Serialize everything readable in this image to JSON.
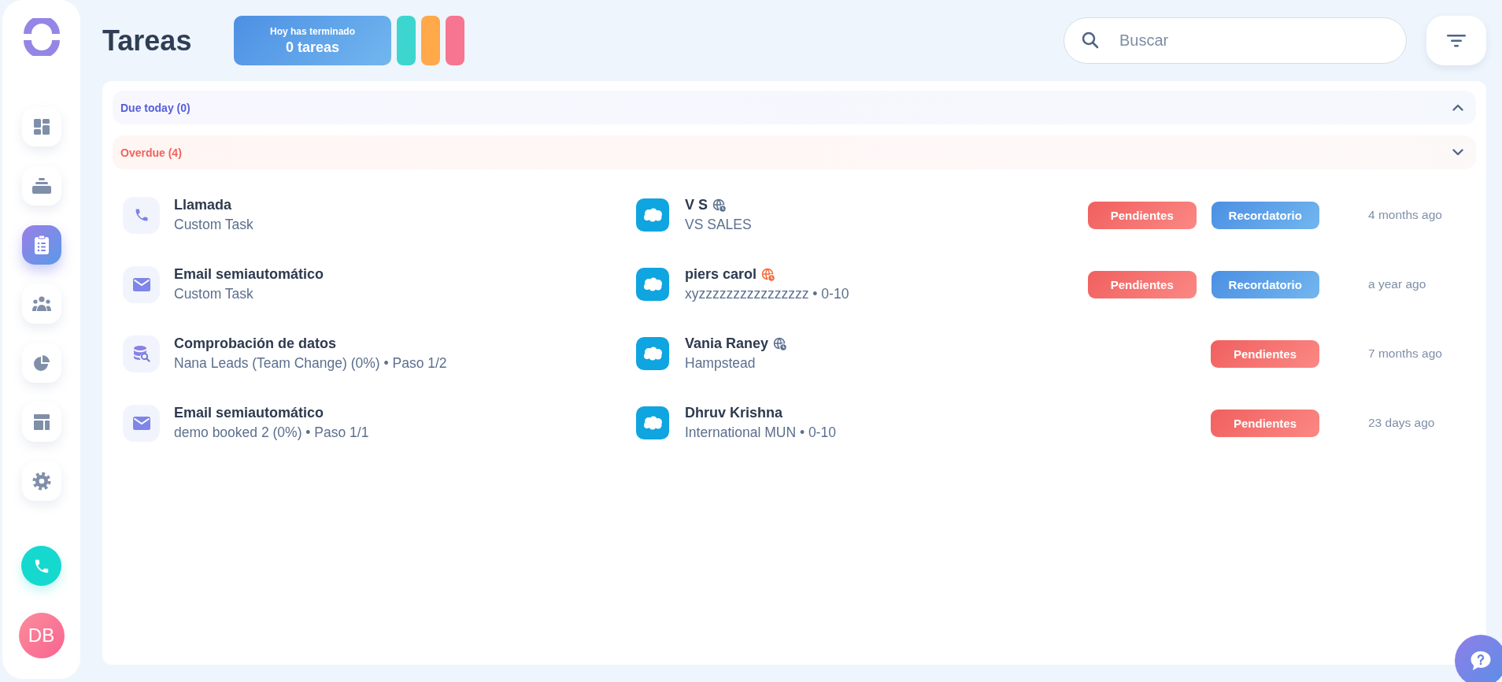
{
  "sidebar": {
    "nav": [
      {
        "kind": "dashboard",
        "selected": false
      },
      {
        "kind": "stack",
        "selected": false
      },
      {
        "kind": "clipboard",
        "selected": true
      },
      {
        "kind": "people",
        "selected": false
      },
      {
        "kind": "pie",
        "selected": false
      },
      {
        "kind": "layout",
        "selected": false
      },
      {
        "kind": "gear",
        "selected": false
      }
    ],
    "avatar": {
      "initials": "DB"
    }
  },
  "header": {
    "title": "Tareas",
    "summary": {
      "caption": "Hoy has terminado",
      "count": "0 tareas"
    },
    "pills": [
      {
        "color": "#3dd6cf"
      },
      {
        "color": "#ffa94a"
      },
      {
        "color": "#f77590"
      }
    ],
    "search": {
      "placeholder": "Buscar"
    }
  },
  "sections": [
    {
      "label": "Due today (0)",
      "kind": "due",
      "expanded": true
    },
    {
      "label": "Overdue (4)",
      "kind": "overdue",
      "expanded": false
    }
  ],
  "tasks": [
    {
      "kind": "call",
      "title": "Llamada",
      "subtitle": "Custom Task",
      "contact": {
        "name": "V S",
        "globe": {
          "color": "#5b6f8e"
        },
        "detail": "VS SALES"
      },
      "badges": [
        {
          "label": "Pendientes",
          "kind": "pending"
        },
        {
          "label": "Recordatorio",
          "kind": "reminder"
        }
      ],
      "time": "4 months ago"
    },
    {
      "kind": "email",
      "title": "Email semiautomático",
      "subtitle": "Custom Task",
      "contact": {
        "name": "piers carol",
        "globe": {
          "color": "#f26b3a"
        },
        "detail": "xyzzzzzzzzzzzzzzzz • 0-10"
      },
      "badges": [
        {
          "label": "Pendientes",
          "kind": "pending"
        },
        {
          "label": "Recordatorio",
          "kind": "reminder"
        }
      ],
      "time": "a year ago"
    },
    {
      "kind": "datacheck",
      "title": "Comprobación de datos",
      "subtitle": "Nana Leads (Team Change) (0%) • Paso 1/2",
      "contact": {
        "name": "Vania Raney",
        "globe": {
          "color": "#5b6f8e"
        },
        "detail": "Hampstead"
      },
      "badges": [
        {
          "label": "Pendientes",
          "kind": "pending"
        }
      ],
      "time": "7 months ago"
    },
    {
      "kind": "email",
      "title": "Email semiautomático",
      "subtitle": "demo booked 2 (0%) • Paso 1/1",
      "contact": {
        "name": "Dhruv Krishna",
        "detail": "International MUN • 0-10"
      },
      "badges": [
        {
          "label": "Pendientes",
          "kind": "pending"
        }
      ],
      "time": "23 days ago"
    }
  ]
}
